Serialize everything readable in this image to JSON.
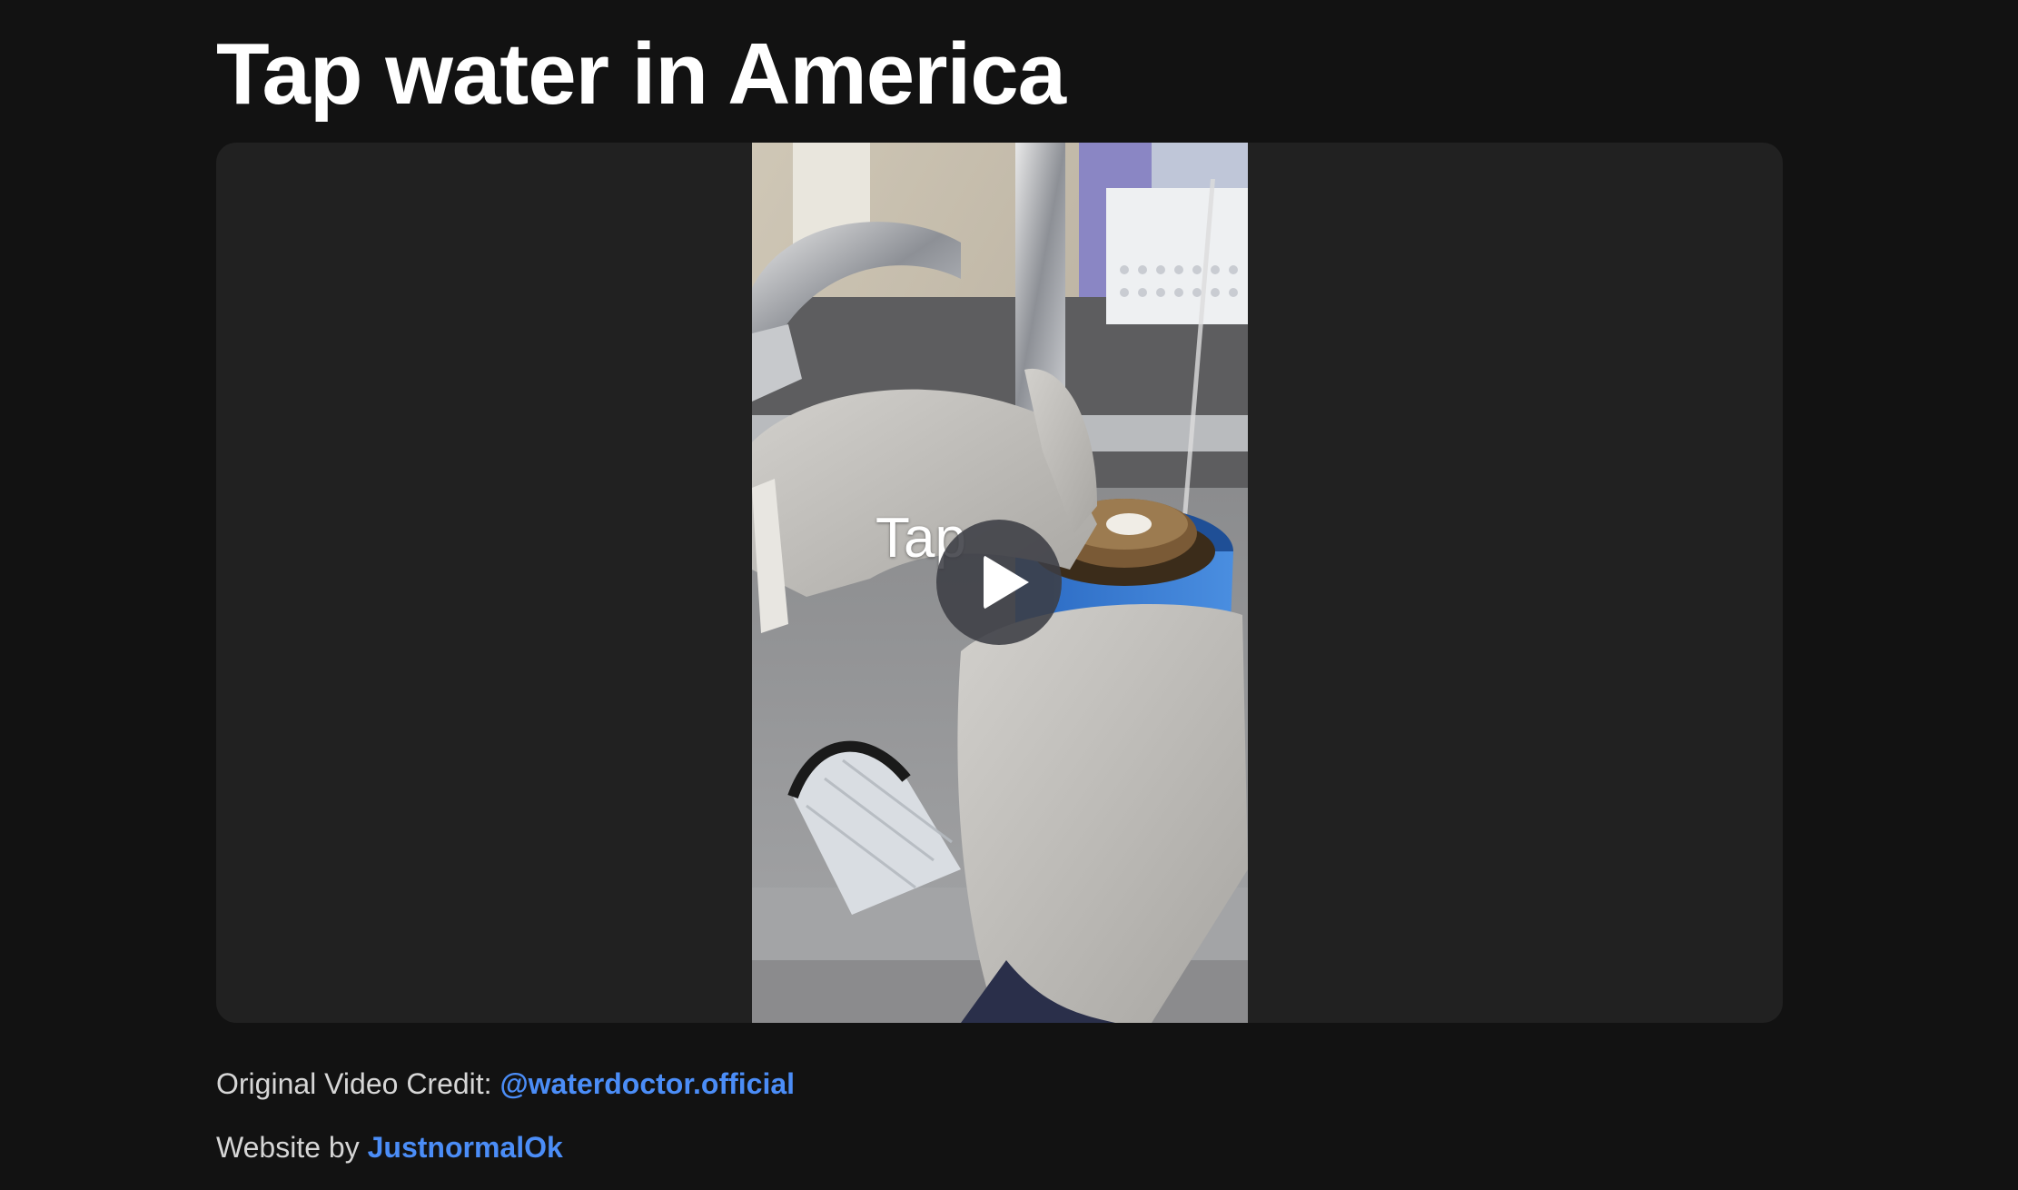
{
  "page": {
    "title": "Tap water in America"
  },
  "video": {
    "caption": "Tap",
    "play_label": "Play"
  },
  "credits": {
    "video_credit_prefix": "Original Video Credit: ",
    "video_credit_link": "@waterdoctor.official",
    "website_prefix": "Website by ",
    "website_link": "JustnormalOk"
  },
  "colors": {
    "background": "#121212",
    "card": "#212121",
    "title": "#ffffff",
    "body_text": "#d6d6d6",
    "link": "#4b8df7"
  },
  "icons": {
    "play": "play-icon"
  }
}
